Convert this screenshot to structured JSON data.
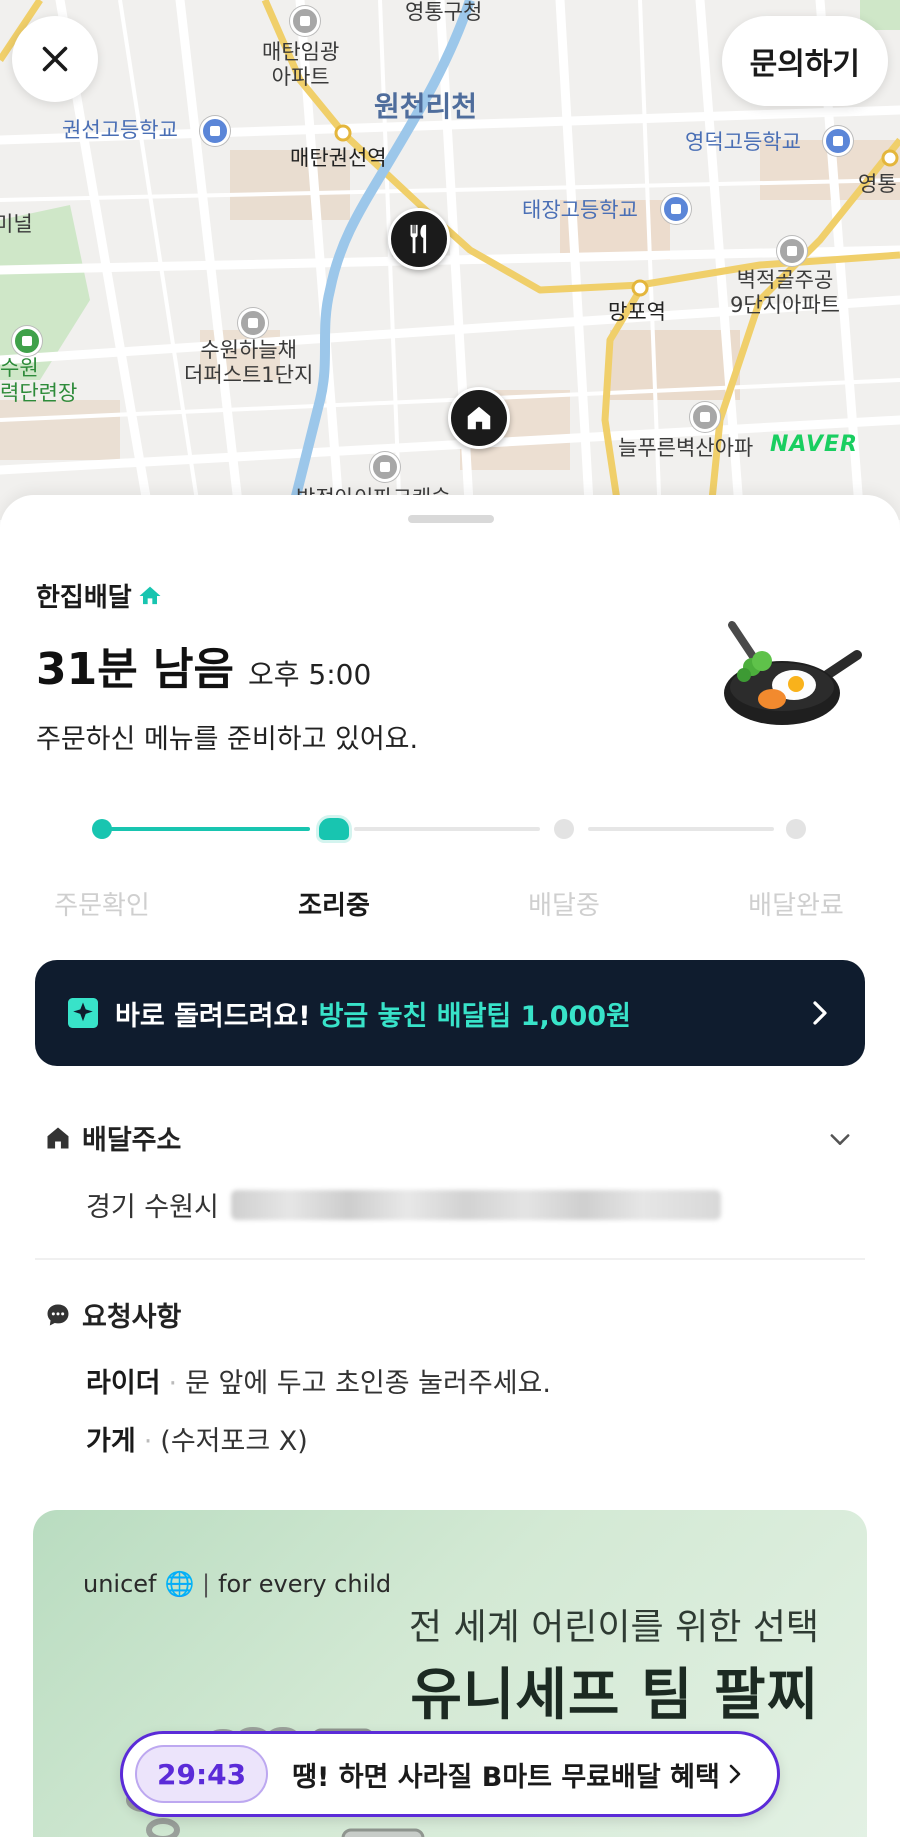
{
  "map": {
    "labels": {
      "yeongtong_district": "영통구청",
      "maetan_apt": "매탄임광\n아파트",
      "wonchon_stream": "원천리천",
      "kwonseon_school": "권선고등학교",
      "maetan_station": "매탄권선역",
      "yeongdeok_school": "영덕고등학교",
      "yeongtong_edge": "영통",
      "terminal_edge": "미널",
      "taejang_school": "태장고등학교",
      "byeokjeok_apt": "벽적골주공\n9단지아파트",
      "mangpo_station": "망포역",
      "suwon_apt": "수원하늘채\n더퍼스트1단지",
      "suwon_park": "수원\n력단련장",
      "neulpureun_apt": "늘푸른벽산아파",
      "bottom_apt": "방정아이파크캐슬"
    },
    "naver_logo": "NAVER",
    "inquiry_button": "문의하기"
  },
  "order": {
    "service": "한집배달",
    "eta_remaining": "31분 남음",
    "eta_time": "오후 5:00",
    "status_message": "주문하신 메뉴를 준비하고 있어요.",
    "steps": [
      {
        "label": "주문확인",
        "state": "done"
      },
      {
        "label": "조리중",
        "state": "current"
      },
      {
        "label": "배달중",
        "state": "pending"
      },
      {
        "label": "배달완료",
        "state": "pending"
      }
    ]
  },
  "promo": {
    "text": "바로 돌려드려요!",
    "highlight": "방금 놓친 배달팁 1,000원"
  },
  "address": {
    "title": "배달주소",
    "prefix": "경기 수원시"
  },
  "requests": {
    "title": "요청사항",
    "items": [
      {
        "key": "라이더",
        "value": "문 앞에 두고 초인종 눌러주세요."
      },
      {
        "key": "가게",
        "value": "(수저포크 X)"
      }
    ]
  },
  "ad": {
    "brand": "unicef",
    "tagline": "for every child",
    "subtitle": "전 세계 어린이를 위한 선택",
    "title": "유니세프 팀 팔찌"
  },
  "timer": {
    "countdown": "29:43",
    "text": "땡! 하면 사라질 B마트 무료배달 혜택"
  },
  "colors": {
    "accent_mint": "#18c5b0",
    "promo_bg": "#0f1c2e",
    "promo_highlight": "#38e3c9",
    "timer_purple": "#5b2bd8",
    "naver_green": "#19ce60"
  }
}
